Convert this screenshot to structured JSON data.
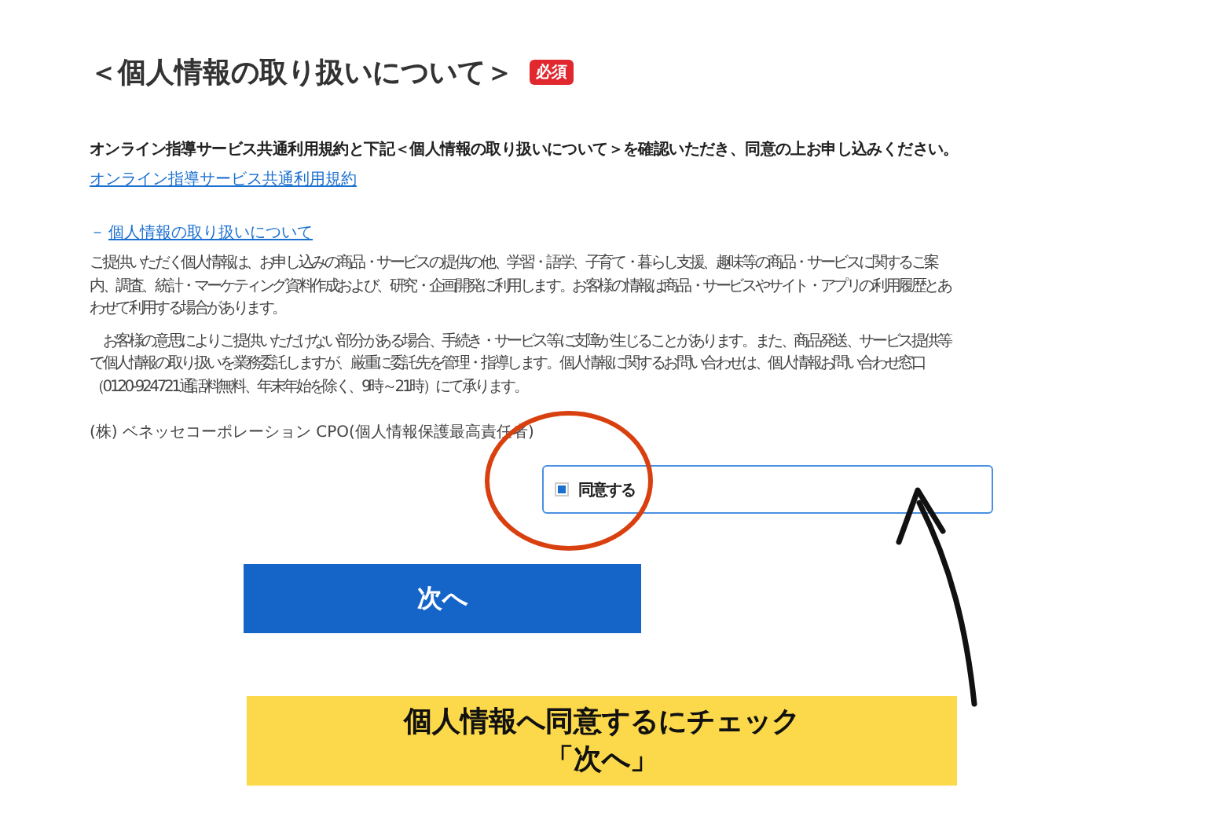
{
  "heading": {
    "title": "＜個人情報の取り扱いについて＞",
    "badge": "必須"
  },
  "intro": "オンライン指導サービス共通利用規約と下記＜個人情報の取り扱いについて＞を確認いただき、同意の上お申し込みください。",
  "terms_link": "オンライン指導サービス共通利用規約",
  "section_toggle": {
    "icon": "－",
    "label": "個人情報の取り扱いについて",
    "expanded": true
  },
  "paragraphs": [
    "ご提供いただく個人情報は、お申し込みの商品・サービスの提供の他、学習・語学、子育て・暮らし支援、趣味等の商品・サービスに関するご案内、調査、統計・マーケティング資料作成および、研究・企画開発に利用します。お客様の情報は商品・サービスやサイト・アプリの利用履歴とあわせて利用する場合があります。",
    "　お客様の意思によりご提供いただけない部分がある場合、手続き・サービス等に支障が生じることがあります。また、商品発送、サービス提供等で個人情報の取り扱いを業務委託しますが、厳重に委託先を管理・指導します。個人情報に関するお問い合わせは、個人情報お問い合わせ窓口（0120-924721通話料無料、年末年始を除く、9時～21時）にて承ります。"
  ],
  "signature": "(株) ベネッセコーポレーション CPO(個人情報保護最高責任者)",
  "agree": {
    "label": "同意する",
    "checked": true
  },
  "next_button": "次へ",
  "annotation": {
    "lines": [
      "個人情報へ同意するにチェック",
      "「次へ」"
    ]
  }
}
